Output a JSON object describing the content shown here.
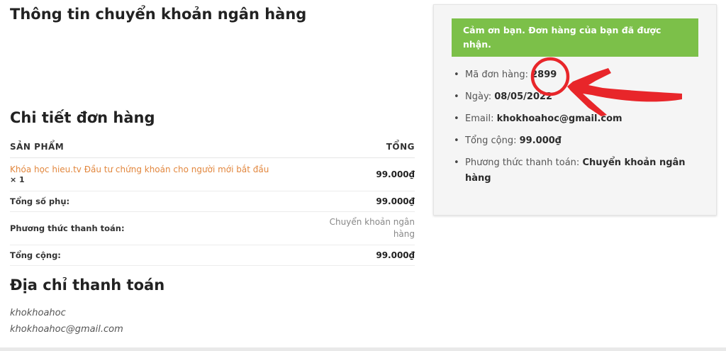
{
  "bank_heading": "Thông tin chuyển khoản ngân hàng",
  "details_heading": "Chi tiết đơn hàng",
  "table": {
    "col_product": "SẢN PHẨM",
    "col_total": "TỔNG",
    "product_name": "Khóa học hieu.tv Đầu tư chứng khoán cho người mới bắt đầu",
    "product_qty": "× 1",
    "product_amount": "99.000₫",
    "subtotal_label": "Tổng số phụ:",
    "subtotal_value": "99.000₫",
    "payment_label": "Phương thức thanh toán:",
    "payment_value": "Chuyển khoản ngân hàng",
    "total_label": "Tổng cộng:",
    "total_value": "99.000₫"
  },
  "billing": {
    "heading": "Địa chỉ thanh toán",
    "name": "khokhoahoc",
    "email": "khokhoahoc@gmail.com"
  },
  "sidebar": {
    "notice": "Cảm ơn bạn. Đơn hàng của bạn đã được nhận.",
    "order_number_label": "Mã đơn hàng:",
    "order_number": "2899",
    "date_label": "Ngày:",
    "date": "08/05/2022",
    "email_label": "Email:",
    "email": "khokhoahoc@gmail.com",
    "total_label": "Tổng cộng:",
    "total": "99.000₫",
    "payment_label": "Phương thức thanh toán:",
    "payment": "Chuyển khoản ngân hàng"
  },
  "colors": {
    "notice_bg": "#7cc049",
    "product_link": "#e2873e",
    "annotation_red": "#e8262a"
  }
}
